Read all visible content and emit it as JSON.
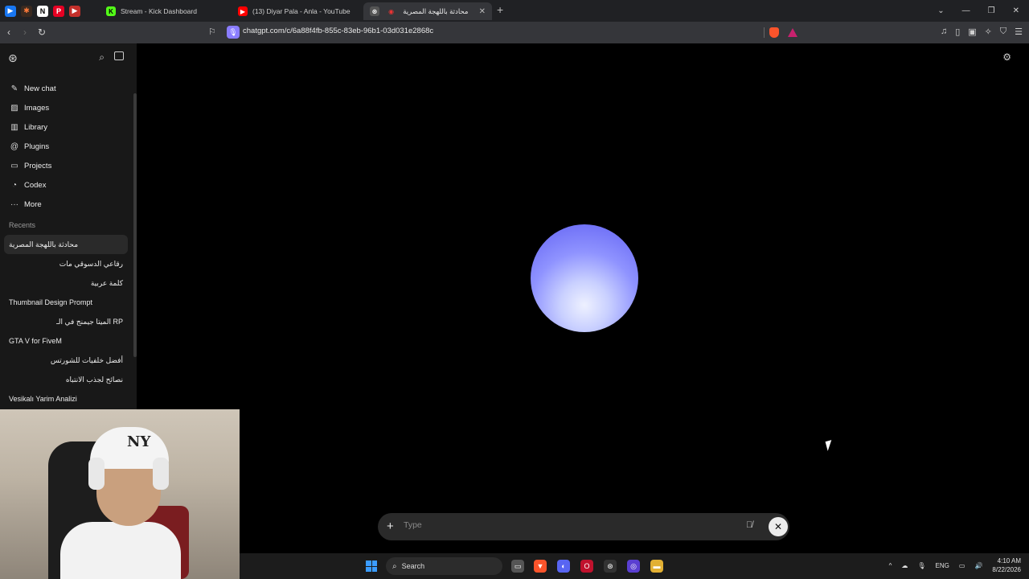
{
  "browser": {
    "tabs": [
      {
        "label": "Stream - Kick Dashboard",
        "favicon": "kick-icon"
      },
      {
        "label": "(13) Diyar Pala - Anla - YouTube",
        "favicon": "youtube-icon"
      },
      {
        "label": "محادثة باللهجة المصرية",
        "favicon": "chatgpt-icon",
        "active": true
      }
    ],
    "new_tab_label": "+",
    "url": "chatgpt.com/c/6a88f4fb-855c-83eb-96b1-03d031e2868c"
  },
  "sidebar": {
    "menu": [
      {
        "label": "New chat",
        "icon": "pencil-square-icon"
      },
      {
        "label": "Images",
        "icon": "images-icon"
      },
      {
        "label": "Library",
        "icon": "library-icon"
      },
      {
        "label": "Plugins",
        "icon": "plugins-icon"
      },
      {
        "label": "Projects",
        "icon": "folder-icon"
      },
      {
        "label": "Codex",
        "icon": "codex-icon"
      },
      {
        "label": "More",
        "icon": "more-dots-icon"
      }
    ],
    "recents_heading": "Recents",
    "recents": [
      {
        "label": "محادثة باللهجة المصرية",
        "selected": true,
        "rtl": false
      },
      {
        "label": "رقاعي الدسوقي مات",
        "rtl": true
      },
      {
        "label": "كلمة عربية",
        "rtl": true
      },
      {
        "label": "Thumbnail Design Prompt",
        "rtl": false
      },
      {
        "label": "الميتا جيمنج في الـ RP",
        "rtl": true
      },
      {
        "label": "GTA V for FiveM",
        "rtl": false
      },
      {
        "label": "أفضل خلفيات للشورتس",
        "rtl": true
      },
      {
        "label": "نصائح لجذب الانتباه",
        "rtl": true
      },
      {
        "label": "Vesikalı Yarim Analizi",
        "rtl": false
      }
    ]
  },
  "composer": {
    "placeholder": "Type"
  },
  "taskbar": {
    "search_label": "Search",
    "lang": "ENG",
    "time": "4:10 AM",
    "date": "8/22/2026"
  },
  "colors": {
    "orb_top": "#5f5ff2",
    "orb_bottom": "#eef1ff",
    "background": "#000000",
    "sidebar": "#181818"
  }
}
